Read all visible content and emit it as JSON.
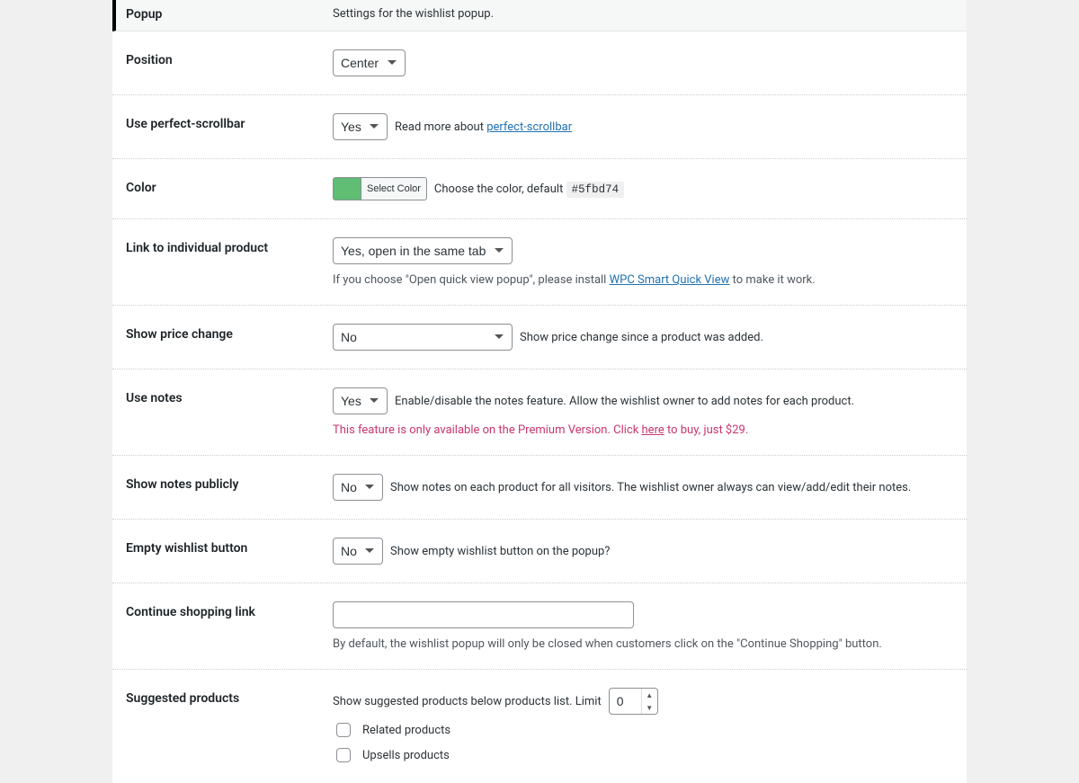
{
  "header": {
    "title": "Popup",
    "desc": "Settings for the wishlist popup."
  },
  "position": {
    "label": "Position",
    "value": "Center"
  },
  "scrollbar": {
    "label": "Use perfect-scrollbar",
    "value": "Yes",
    "help_prefix": "Read more about ",
    "link": "perfect-scrollbar"
  },
  "color": {
    "label": "Color",
    "swatch": "#5fbd74",
    "btn": "Select Color",
    "help_prefix": "Choose the color, default ",
    "code": "#5fbd74"
  },
  "link_product": {
    "label": "Link to individual product",
    "value": "Yes, open in the same tab",
    "help_prefix": "If you choose \"Open quick view popup\", please install ",
    "link": "WPC Smart Quick View",
    "help_suffix": " to make it work."
  },
  "price_change": {
    "label": "Show price change",
    "value": "No",
    "help": "Show price change since a product was added."
  },
  "use_notes": {
    "label": "Use notes",
    "value": "Yes",
    "help": "Enable/disable the notes feature. Allow the wishlist owner to add notes for each product.",
    "premium_prefix": "This feature is only available on the Premium Version. Click ",
    "premium_link": "here",
    "premium_suffix": " to buy, just $29."
  },
  "notes_public": {
    "label": "Show notes publicly",
    "value": "No",
    "help": "Show notes on each product for all visitors. The wishlist owner always can view/add/edit their notes."
  },
  "empty_btn": {
    "label": "Empty wishlist button",
    "value": "No",
    "help": "Show empty wishlist button on the popup?"
  },
  "continue": {
    "label": "Continue shopping link",
    "value": "",
    "help": "By default, the wishlist popup will only be closed when customers click on the \"Continue Shopping\" button."
  },
  "suggested": {
    "label": "Suggested products",
    "help": "Show suggested products below products list. Limit",
    "limit": "0",
    "cb1": "Related products",
    "cb2": "Upsells products"
  }
}
